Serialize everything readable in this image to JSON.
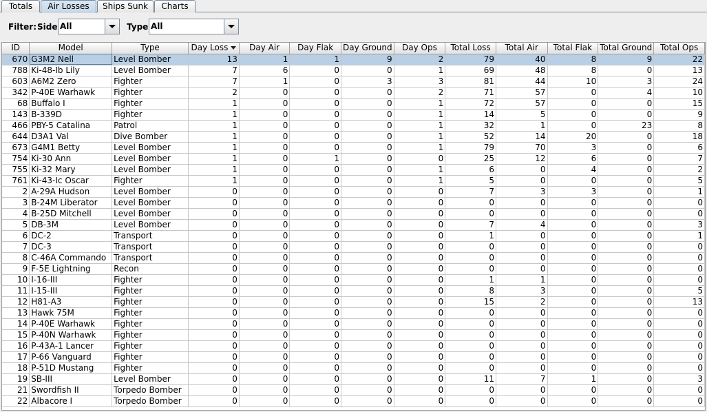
{
  "tabs": [
    {
      "label": "Totals"
    },
    {
      "label": "Air Losses"
    },
    {
      "label": "Ships Sunk"
    },
    {
      "label": "Charts"
    }
  ],
  "active_tab": "Air Losses",
  "filter": {
    "label": "Filter:",
    "side_label": "Side:",
    "side_value": "All",
    "type_label": "Type:",
    "type_value": "All"
  },
  "table": {
    "sort_column": "Day Loss",
    "sort_direction": "descending",
    "columns": [
      "ID",
      "Model",
      "Type",
      "Day Loss",
      "Day Air",
      "Day Flak",
      "Day Ground",
      "Day Ops",
      "Total Loss",
      "Total Air",
      "Total Flak",
      "Total Ground",
      "Total Ops"
    ],
    "selected_row": 0,
    "rows": [
      [
        "670",
        "G3M2 Nell",
        "Level Bomber",
        "13",
        "1",
        "1",
        "9",
        "2",
        "79",
        "40",
        "8",
        "9",
        "22"
      ],
      [
        "788",
        "Ki-48-Ib Lily",
        "Level Bomber",
        "7",
        "6",
        "0",
        "0",
        "1",
        "69",
        "48",
        "8",
        "0",
        "13"
      ],
      [
        "603",
        "A6M2 Zero",
        "Fighter",
        "7",
        "1",
        "0",
        "3",
        "3",
        "81",
        "44",
        "10",
        "3",
        "24"
      ],
      [
        "342",
        "P-40E Warhawk",
        "Fighter",
        "2",
        "0",
        "0",
        "0",
        "2",
        "71",
        "57",
        "0",
        "4",
        "10"
      ],
      [
        "68",
        "Buffalo I",
        "Fighter",
        "1",
        "0",
        "0",
        "0",
        "1",
        "72",
        "57",
        "0",
        "0",
        "15"
      ],
      [
        "143",
        "B-339D",
        "Fighter",
        "1",
        "0",
        "0",
        "0",
        "1",
        "14",
        "5",
        "0",
        "0",
        "9"
      ],
      [
        "466",
        "PBY-5 Catalina",
        "Patrol",
        "1",
        "0",
        "0",
        "0",
        "1",
        "32",
        "1",
        "0",
        "23",
        "8"
      ],
      [
        "644",
        "D3A1 Val",
        "Dive Bomber",
        "1",
        "0",
        "0",
        "0",
        "1",
        "52",
        "14",
        "20",
        "0",
        "18"
      ],
      [
        "673",
        "G4M1 Betty",
        "Level Bomber",
        "1",
        "0",
        "0",
        "0",
        "1",
        "79",
        "70",
        "3",
        "0",
        "6"
      ],
      [
        "754",
        "Ki-30 Ann",
        "Level Bomber",
        "1",
        "0",
        "1",
        "0",
        "0",
        "25",
        "12",
        "6",
        "0",
        "7"
      ],
      [
        "755",
        "Ki-32 Mary",
        "Level Bomber",
        "1",
        "0",
        "0",
        "0",
        "1",
        "6",
        "0",
        "4",
        "0",
        "2"
      ],
      [
        "761",
        "Ki-43-Ic Oscar",
        "Fighter",
        "1",
        "0",
        "0",
        "0",
        "1",
        "5",
        "0",
        "0",
        "0",
        "5"
      ],
      [
        "2",
        "A-29A Hudson",
        "Level Bomber",
        "0",
        "0",
        "0",
        "0",
        "0",
        "7",
        "3",
        "3",
        "0",
        "1"
      ],
      [
        "3",
        "B-24M Liberator",
        "Level Bomber",
        "0",
        "0",
        "0",
        "0",
        "0",
        "0",
        "0",
        "0",
        "0",
        "0"
      ],
      [
        "4",
        "B-25D Mitchell",
        "Level Bomber",
        "0",
        "0",
        "0",
        "0",
        "0",
        "0",
        "0",
        "0",
        "0",
        "0"
      ],
      [
        "5",
        "DB-3M",
        "Level Bomber",
        "0",
        "0",
        "0",
        "0",
        "0",
        "7",
        "4",
        "0",
        "0",
        "3"
      ],
      [
        "6",
        "DC-2",
        "Transport",
        "0",
        "0",
        "0",
        "0",
        "0",
        "1",
        "0",
        "0",
        "0",
        "1"
      ],
      [
        "7",
        "DC-3",
        "Transport",
        "0",
        "0",
        "0",
        "0",
        "0",
        "0",
        "0",
        "0",
        "0",
        "0"
      ],
      [
        "8",
        "C-46A Commando",
        "Transport",
        "0",
        "0",
        "0",
        "0",
        "0",
        "0",
        "0",
        "0",
        "0",
        "0"
      ],
      [
        "9",
        "F-5E Lightning",
        "Recon",
        "0",
        "0",
        "0",
        "0",
        "0",
        "0",
        "0",
        "0",
        "0",
        "0"
      ],
      [
        "10",
        "I-16-III",
        "Fighter",
        "0",
        "0",
        "0",
        "0",
        "0",
        "1",
        "1",
        "0",
        "0",
        "0"
      ],
      [
        "11",
        "I-15-III",
        "Fighter",
        "0",
        "0",
        "0",
        "0",
        "0",
        "8",
        "3",
        "0",
        "0",
        "5"
      ],
      [
        "12",
        "H81-A3",
        "Fighter",
        "0",
        "0",
        "0",
        "0",
        "0",
        "15",
        "2",
        "0",
        "0",
        "13"
      ],
      [
        "13",
        "Hawk 75M",
        "Fighter",
        "0",
        "0",
        "0",
        "0",
        "0",
        "0",
        "0",
        "0",
        "0",
        "0"
      ],
      [
        "14",
        "P-40E Warhawk",
        "Fighter",
        "0",
        "0",
        "0",
        "0",
        "0",
        "0",
        "0",
        "0",
        "0",
        "0"
      ],
      [
        "15",
        "P-40N Warhawk",
        "Fighter",
        "0",
        "0",
        "0",
        "0",
        "0",
        "0",
        "0",
        "0",
        "0",
        "0"
      ],
      [
        "16",
        "P-43A-1 Lancer",
        "Fighter",
        "0",
        "0",
        "0",
        "0",
        "0",
        "0",
        "0",
        "0",
        "0",
        "0"
      ],
      [
        "17",
        "P-66 Vanguard",
        "Fighter",
        "0",
        "0",
        "0",
        "0",
        "0",
        "0",
        "0",
        "0",
        "0",
        "0"
      ],
      [
        "18",
        "P-51D Mustang",
        "Fighter",
        "0",
        "0",
        "0",
        "0",
        "0",
        "0",
        "0",
        "0",
        "0",
        "0"
      ],
      [
        "19",
        "SB-III",
        "Level Bomber",
        "0",
        "0",
        "0",
        "0",
        "0",
        "11",
        "7",
        "1",
        "0",
        "3"
      ],
      [
        "21",
        "Swordfish II",
        "Torpedo Bomber",
        "0",
        "0",
        "0",
        "0",
        "0",
        "0",
        "0",
        "0",
        "0",
        "0"
      ],
      [
        "22",
        "Albacore I",
        "Torpedo Bomber",
        "0",
        "0",
        "0",
        "0",
        "0",
        "0",
        "0",
        "0",
        "0",
        "0"
      ]
    ]
  }
}
